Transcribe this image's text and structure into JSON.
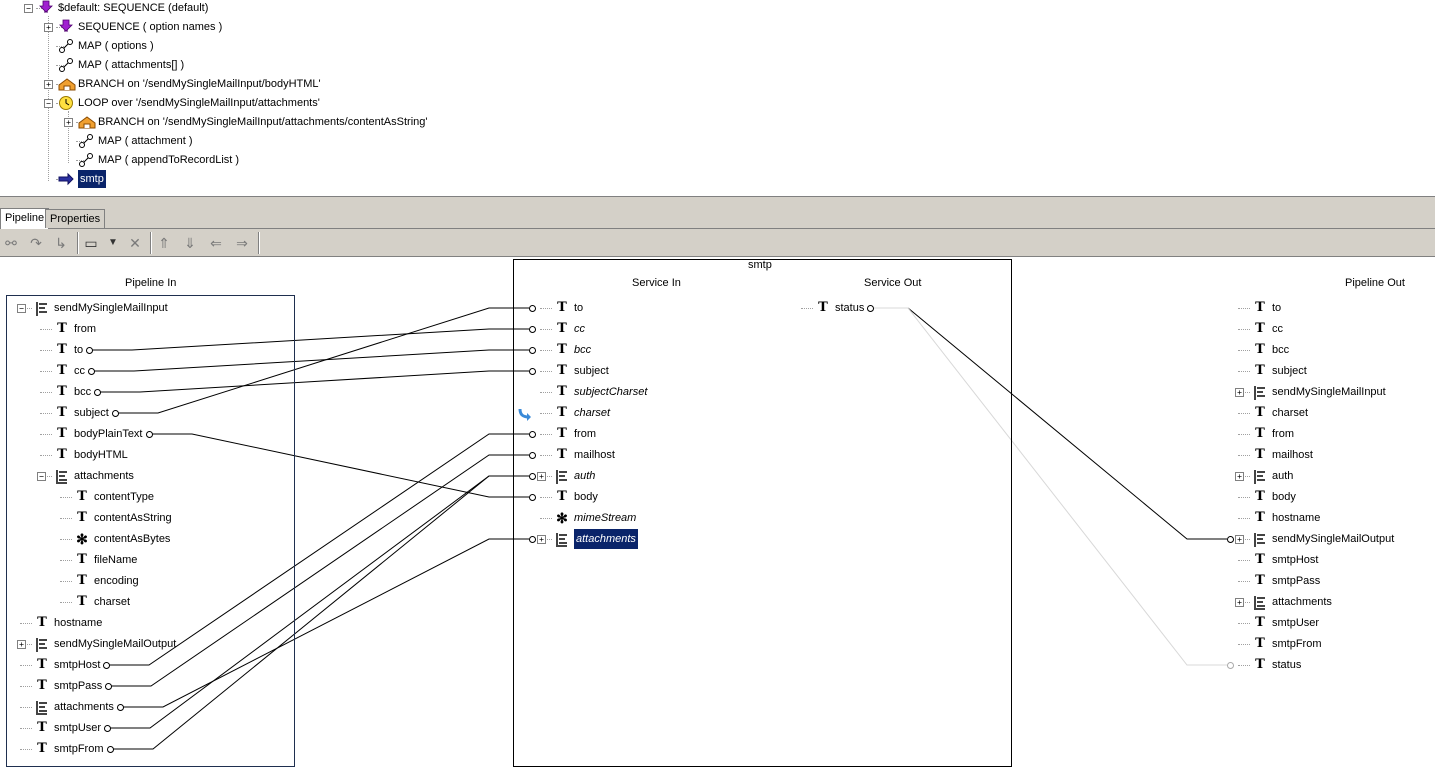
{
  "flow": {
    "rows": [
      {
        "label": "$default: SEQUENCE (default)",
        "icon": "sequence-icon",
        "expander": "−"
      },
      {
        "label": "SEQUENCE ( option names )",
        "icon": "sequence-icon",
        "expander": "+"
      },
      {
        "label": "MAP ( options )",
        "icon": "map-icon",
        "expander": ""
      },
      {
        "label": "MAP ( attachments[] )",
        "icon": "map-icon",
        "expander": ""
      },
      {
        "label": "BRANCH on '/sendMySingleMailInput/bodyHTML'",
        "icon": "branch-icon",
        "expander": "+"
      },
      {
        "label": "LOOP over '/sendMySingleMailInput/attachments'",
        "icon": "loop-icon",
        "expander": "−"
      },
      {
        "label": "BRANCH on '/sendMySingleMailInput/attachments/contentAsString'",
        "icon": "branch-icon",
        "expander": "+"
      },
      {
        "label": "MAP ( attachment )",
        "icon": "map-icon",
        "expander": ""
      },
      {
        "label": "MAP ( appendToRecordList )",
        "icon": "map-icon",
        "expander": ""
      },
      {
        "label": "smtp",
        "icon": "invoke-icon",
        "expander": "",
        "selected": true
      }
    ]
  },
  "tabs": [
    "Pipeline",
    "Properties"
  ],
  "toolbar": {
    "buttons": [
      "link-icon",
      "redo-icon",
      "move-icon",
      "new-icon",
      "dropdown-icon",
      "delete-icon",
      "shift-up-icon",
      "shift-down-icon",
      "shift-left-icon",
      "shift-right-icon"
    ]
  },
  "editor": {
    "service_title": "smtp",
    "headers": {
      "pipeline_in": "Pipeline In",
      "service_in": "Service In",
      "service_out": "Service Out",
      "pipeline_out": "Pipeline Out"
    },
    "pipeline_in": [
      {
        "label": "sendMySingleMailInput",
        "type": "doc",
        "level": 0,
        "expander": "−"
      },
      {
        "label": "from",
        "type": "str",
        "level": 1
      },
      {
        "label": "to",
        "type": "str",
        "level": 1
      },
      {
        "label": "cc",
        "type": "str",
        "level": 1
      },
      {
        "label": "bcc",
        "type": "str",
        "level": 1
      },
      {
        "label": "subject",
        "type": "str",
        "level": 1
      },
      {
        "label": "bodyPlainText",
        "type": "str",
        "level": 1
      },
      {
        "label": "bodyHTML",
        "type": "str",
        "level": 1
      },
      {
        "label": "attachments",
        "type": "doclist",
        "level": 1,
        "expander": "−"
      },
      {
        "label": "contentType",
        "type": "str",
        "level": 2
      },
      {
        "label": "contentAsString",
        "type": "str",
        "level": 2
      },
      {
        "label": "contentAsBytes",
        "type": "obj",
        "level": 2
      },
      {
        "label": "fileName",
        "type": "str",
        "level": 2
      },
      {
        "label": "encoding",
        "type": "str",
        "level": 2
      },
      {
        "label": "charset",
        "type": "str",
        "level": 2
      },
      {
        "label": "hostname",
        "type": "str",
        "level": 0
      },
      {
        "label": "sendMySingleMailOutput",
        "type": "doc",
        "level": 0,
        "expander": "+"
      },
      {
        "label": "smtpHost",
        "type": "str",
        "level": 0
      },
      {
        "label": "smtpPass",
        "type": "str",
        "level": 0
      },
      {
        "label": "attachments",
        "type": "doclist",
        "level": 0
      },
      {
        "label": "smtpUser",
        "type": "str",
        "level": 0
      },
      {
        "label": "smtpFrom",
        "type": "str",
        "level": 0
      }
    ],
    "service_in": [
      {
        "label": "to",
        "type": "str",
        "italic": false
      },
      {
        "label": "cc",
        "type": "str",
        "italic": true
      },
      {
        "label": "bcc",
        "type": "str",
        "italic": true
      },
      {
        "label": "subject",
        "type": "str",
        "italic": false
      },
      {
        "label": "subjectCharset",
        "type": "str",
        "italic": true
      },
      {
        "label": "charset",
        "type": "str",
        "italic": true,
        "set_value_icon": true
      },
      {
        "label": "from",
        "type": "str",
        "italic": false
      },
      {
        "label": "mailhost",
        "type": "str",
        "italic": false
      },
      {
        "label": "auth",
        "type": "doc",
        "italic": true,
        "expander": "+"
      },
      {
        "label": "body",
        "type": "str",
        "italic": false
      },
      {
        "label": "mimeStream",
        "type": "obj",
        "italic": true
      },
      {
        "label": "attachments",
        "type": "doclist",
        "italic": true,
        "expander": "+",
        "selected": true
      }
    ],
    "service_out": [
      {
        "label": "status",
        "type": "str"
      }
    ],
    "pipeline_out": [
      {
        "label": "to",
        "type": "str"
      },
      {
        "label": "cc",
        "type": "str"
      },
      {
        "label": "bcc",
        "type": "str"
      },
      {
        "label": "subject",
        "type": "str"
      },
      {
        "label": "sendMySingleMailInput",
        "type": "doc",
        "expander": "+"
      },
      {
        "label": "charset",
        "type": "str"
      },
      {
        "label": "from",
        "type": "str"
      },
      {
        "label": "mailhost",
        "type": "str"
      },
      {
        "label": "auth",
        "type": "doc",
        "expander": "+"
      },
      {
        "label": "body",
        "type": "str"
      },
      {
        "label": "hostname",
        "type": "str"
      },
      {
        "label": "sendMySingleMailOutput",
        "type": "doc",
        "expander": "+"
      },
      {
        "label": "smtpHost",
        "type": "str"
      },
      {
        "label": "smtpPass",
        "type": "str"
      },
      {
        "label": "attachments",
        "type": "doclist",
        "expander": "+"
      },
      {
        "label": "smtpUser",
        "type": "str"
      },
      {
        "label": "smtpFrom",
        "type": "str"
      },
      {
        "label": "status",
        "type": "str"
      }
    ],
    "links": [
      {
        "from": "pipeline_in.to",
        "to": "service_in.cc"
      },
      {
        "from": "pipeline_in.cc",
        "to": "service_in.bcc"
      },
      {
        "from": "pipeline_in.bcc",
        "to": "service_in.subject"
      },
      {
        "from": "pipeline_in.subject",
        "to": "service_in.to"
      },
      {
        "from": "pipeline_in.bodyPlainText",
        "to": "service_in.body"
      },
      {
        "from": "pipeline_in.smtpHost",
        "to": "service_in.from"
      },
      {
        "from": "pipeline_in.smtpPass",
        "to": "service_in.mailhost"
      },
      {
        "from": "pipeline_in.attachments",
        "to": "service_in.attachments"
      },
      {
        "from": "pipeline_in.smtpUser",
        "to": "service_in.auth"
      },
      {
        "from": "pipeline_in.smtpFrom",
        "to": "service_in.auth"
      },
      {
        "from": "service_out.status",
        "to": "pipeline_out.sendMySingleMailOutput"
      },
      {
        "from": "service_out.status",
        "to": "pipeline_out.status",
        "faint": true
      }
    ]
  }
}
